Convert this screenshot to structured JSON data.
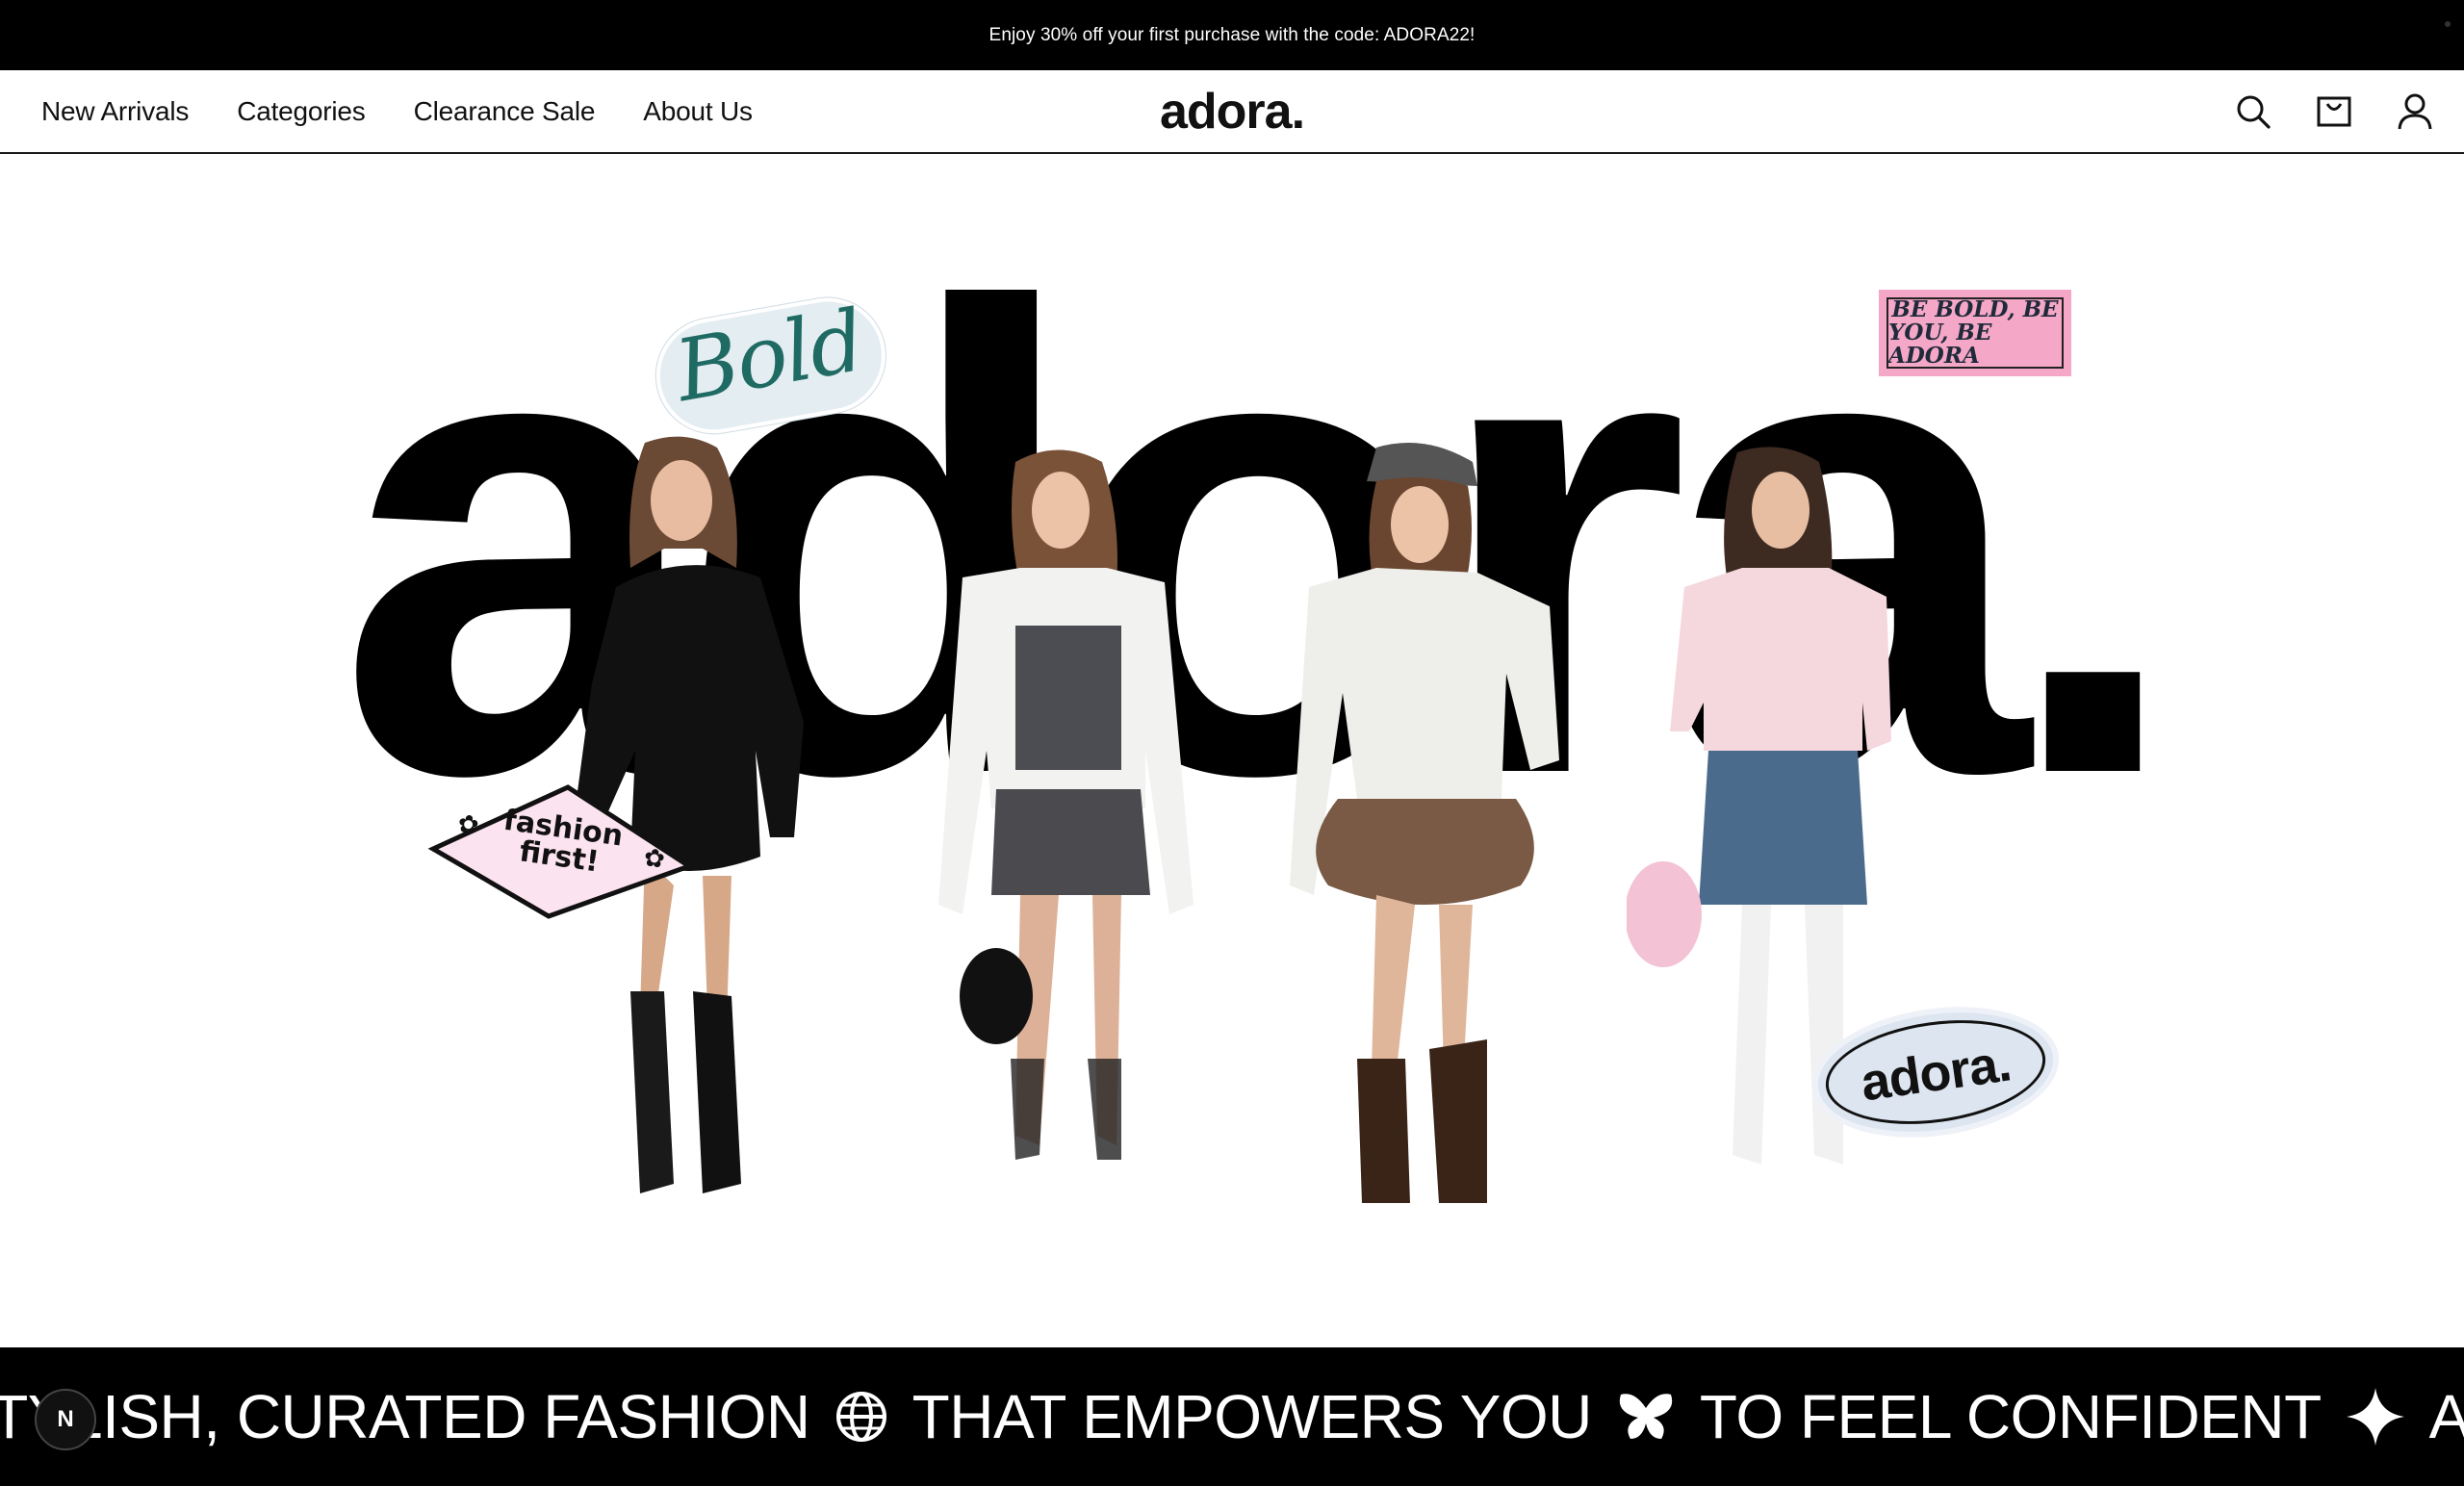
{
  "announcement": {
    "text": "Enjoy 30% off your first purchase with the code: ADORA22!"
  },
  "nav": {
    "items": [
      {
        "label": "New Arrivals"
      },
      {
        "label": "Categories"
      },
      {
        "label": "Clearance Sale"
      },
      {
        "label": "About Us"
      }
    ]
  },
  "brand": {
    "logo": "adora."
  },
  "header_icons": [
    "search-icon",
    "shopping-bag-icon",
    "account-icon"
  ],
  "hero": {
    "word": "adora.",
    "stickers": {
      "bold": "Bold",
      "be_bold_line1": "BE BOLD, BE",
      "be_bold_line2": "YOU, BE ADORA",
      "fashion_line1": "fashion",
      "fashion_line2": "first!",
      "oval": "adora."
    }
  },
  "marquee": {
    "segments": [
      "STYLISH, CURATED FASHION",
      "THAT EMPOWERS YOU",
      "TO FEEL CONFIDENT",
      "AND BEA"
    ],
    "symbols": [
      "globe-icon",
      "butterfly-icon",
      "sparkle-icon"
    ]
  },
  "badge": {
    "label": "N"
  },
  "colors": {
    "black": "#000000",
    "sticker_pink": "#f4a7c6",
    "sticker_light_pink": "#fbe3ef",
    "sticker_oval_blue": "#dde5f0",
    "bold_teal": "#1f6b63"
  }
}
